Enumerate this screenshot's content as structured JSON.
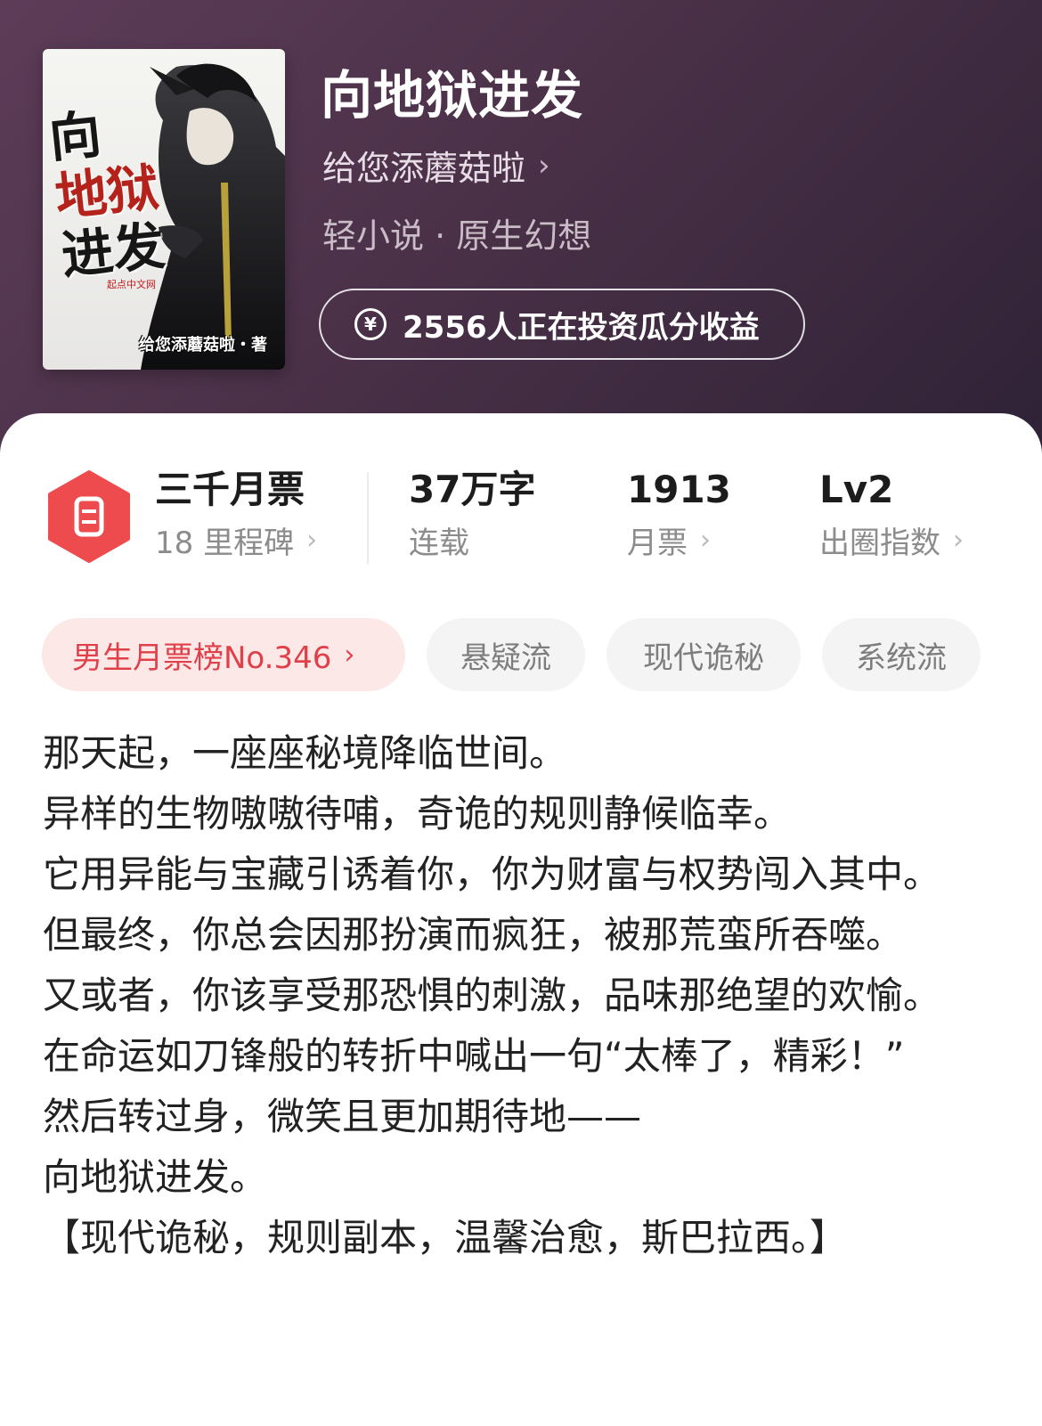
{
  "book": {
    "title": "向地狱进发",
    "author": "给您添蘑菇啦",
    "genre": "轻小说 · 原生幻想",
    "invest_text": "2556人正在投资瓜分收益",
    "invest_icon": "yen-circle-icon",
    "cover": {
      "title_line1": "向",
      "title_line2": "地狱",
      "title_line3": "进发",
      "publisher": "起点中文网",
      "author_credit": "给您添蘑菇啦・著"
    }
  },
  "stats": {
    "ticket": {
      "main": "三千月票",
      "sub": "18 里程碑",
      "icon": "ticket-icon",
      "color": "#ee4b4e"
    },
    "words": {
      "main": "37万字",
      "sub": "连载"
    },
    "monthly": {
      "main": "1913",
      "sub": "月票"
    },
    "level": {
      "main": "Lv2",
      "sub": "出圈指数"
    }
  },
  "tags": {
    "rank": "男生月票榜No.346",
    "items": [
      "悬疑流",
      "现代诡秘",
      "系统流"
    ]
  },
  "description": [
    "那天起，一座座秘境降临世间。",
    "异样的生物嗷嗷待哺，奇诡的规则静候临幸。",
    "它用异能与宝藏引诱着你，你为财富与权势闯入其中。",
    "但最终，你总会因那扮演而疯狂，被那荒蛮所吞噬。",
    "又或者，你该享受那恐惧的刺激，品味那绝望的欢愉。",
    "在命运如刀锋般的转折中喊出一句“太棒了，精彩！”",
    "然后转过身，微笑且更加期待地——",
    "向地狱进发。",
    "【现代诡秘，规则副本，温馨治愈，斯巴拉西。】"
  ],
  "colors": {
    "hero_bg": "#4a3148",
    "accent_red": "#e0404a",
    "rank_tag_bg": "#fde8e8"
  }
}
